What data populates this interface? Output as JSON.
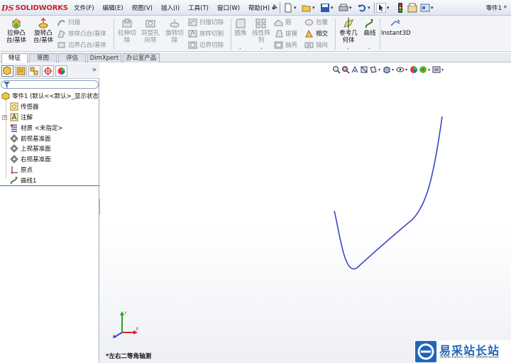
{
  "app": {
    "logo_prefix": "DS",
    "logo_text": "SOLIDWORKS",
    "document_title": "零件1 *",
    "brand_color": "#d21f26"
  },
  "menu": {
    "items": [
      "文件(F)",
      "编辑(E)",
      "视图(V)",
      "插入(I)",
      "工具(T)",
      "窗口(W)",
      "帮助(H)"
    ]
  },
  "ribbon": {
    "extruded_boss": [
      "拉伸凸",
      "台/基体"
    ],
    "revolved_boss": [
      "旋转凸",
      "台/基体"
    ],
    "sweep": "扫描",
    "loft_boss": "放样凸台/基体",
    "boundary_boss": "边界凸台/基体",
    "extruded_cut": [
      "拉伸切",
      "除"
    ],
    "hole_wizard": [
      "异型孔",
      "向导"
    ],
    "revolved_cut": [
      "旋转切",
      "除"
    ],
    "swept_cut": "扫描切除",
    "lofted_cut": "放样切割",
    "boundary_cut": "边界切除",
    "fillet": "圆角",
    "linear_pattern": [
      "线性阵",
      "列"
    ],
    "rib": "筋",
    "draft": "拔模",
    "shell": "抽壳",
    "wrap": "包覆",
    "intersect": "相交",
    "mirror": "镜向",
    "ref_geometry": [
      "参考几",
      "何体"
    ],
    "curves": "曲线",
    "instant3d": "Instant3D"
  },
  "tabs": [
    {
      "label": "特征",
      "active": true
    },
    {
      "label": "草图",
      "active": false
    },
    {
      "label": "评估",
      "active": false
    },
    {
      "label": "DimXpert",
      "active": false
    },
    {
      "label": "办公室产品",
      "active": false
    }
  ],
  "panel": {
    "collapse_glyph": "»",
    "tree": [
      {
        "label": "零件1  (默认<<默认>_显示状态",
        "icon": "part-icon"
      },
      {
        "label": "传感器",
        "icon": "sensor-icon"
      },
      {
        "label": "注解",
        "icon": "annotations-icon"
      },
      {
        "label": "材质 <未指定>",
        "icon": "material-icon"
      },
      {
        "label": "前视基准面",
        "icon": "plane-icon"
      },
      {
        "label": "上视基准面",
        "icon": "plane-icon"
      },
      {
        "label": "右视基准面",
        "icon": "plane-icon"
      },
      {
        "label": "原点",
        "icon": "origin-icon"
      },
      {
        "label": "曲线1",
        "icon": "curve-icon"
      }
    ]
  },
  "graphics": {
    "view_label": "*左右二等角轴测",
    "curve_color": "#3b45c8",
    "axis_labels": {
      "y": "Y",
      "x": "X"
    }
  },
  "watermark": {
    "title": "易采站长站",
    "subtitle": "Www.Easck.Com Webmaster"
  }
}
